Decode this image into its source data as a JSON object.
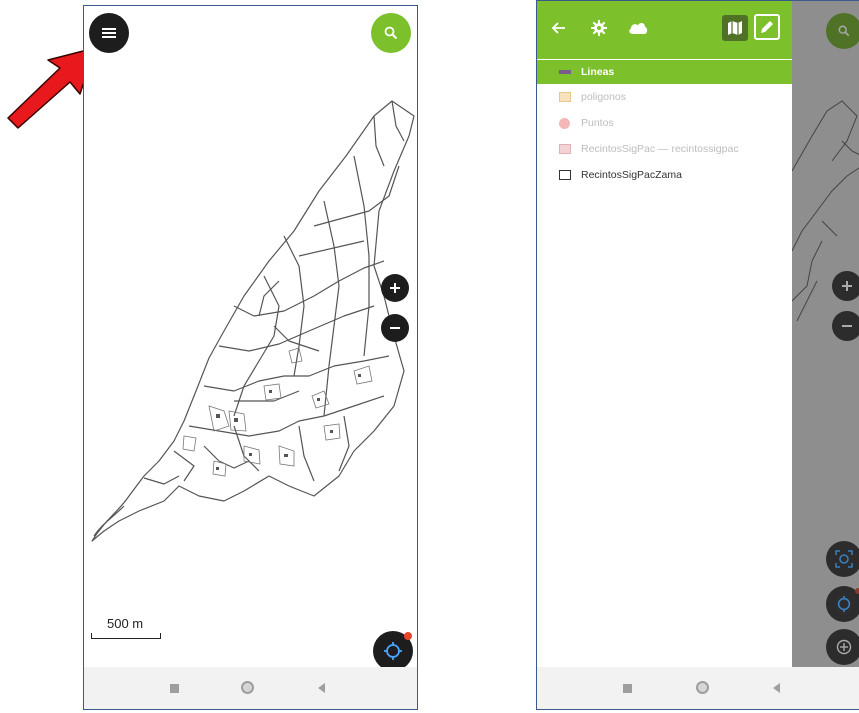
{
  "left_screen": {
    "scale_label": "500 m",
    "buttons": {
      "menu_icon": "menu-icon",
      "search_icon": "search-icon",
      "zoom_in_icon": "plus-icon",
      "zoom_out_icon": "minus-icon",
      "location_icon": "crosshair-icon"
    }
  },
  "right_screen": {
    "toolbar_icons": [
      "back-arrow-icon",
      "gear-icon",
      "cloud-icon",
      "map-icon",
      "pencil-icon"
    ],
    "layers": [
      {
        "label": "Lineas",
        "state": "active"
      },
      {
        "label": "poligonos",
        "state": "hidden"
      },
      {
        "label": "Puntos",
        "state": "hidden"
      },
      {
        "label": "RecintosSigPac — recintossigpac",
        "state": "hidden"
      },
      {
        "label": "RecintosSigPacZama",
        "state": "visible"
      }
    ]
  },
  "colors": {
    "accent_green": "#7cc02b",
    "fab_dark": "#1d1d1d",
    "annotation_arrow": "#e8191c",
    "location_badge": "#e8442a"
  }
}
